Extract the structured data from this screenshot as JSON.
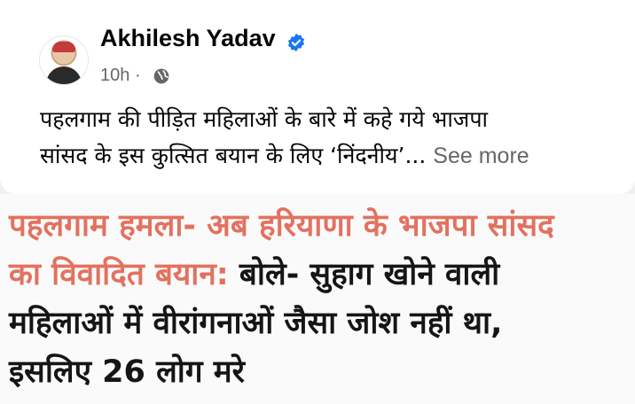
{
  "post": {
    "author": "Akhilesh Yadav",
    "time": "10h",
    "separator": "·",
    "text_line1": "पहलगाम की पीड़ित महिलाओं के बारे में कहे गये भाजपा",
    "text_line2": "सांसद के इस कुत्सित बयान के लिए ‘निंदनीय’...",
    "see_more": "See more",
    "icons": [
      "verified-badge-icon",
      "globe-icon"
    ],
    "colors": {
      "verified": "#1877f2",
      "meta": "#65676b"
    }
  },
  "image": {
    "headline_red1": "पहलगाम हमला- अब हरियाणा के भाजपा सांसद",
    "headline_red2": "का विवादित बयान:",
    "headline_dark2": " बोले- सुहाग खोने वाली",
    "headline_line3": "महिलाओं में वीरांगनाओं जैसा जोश नहीं था,",
    "headline_line4": "इसलिए 26 लोग मरे",
    "colors": {
      "red": "#e3715f",
      "dark": "#151515"
    }
  }
}
